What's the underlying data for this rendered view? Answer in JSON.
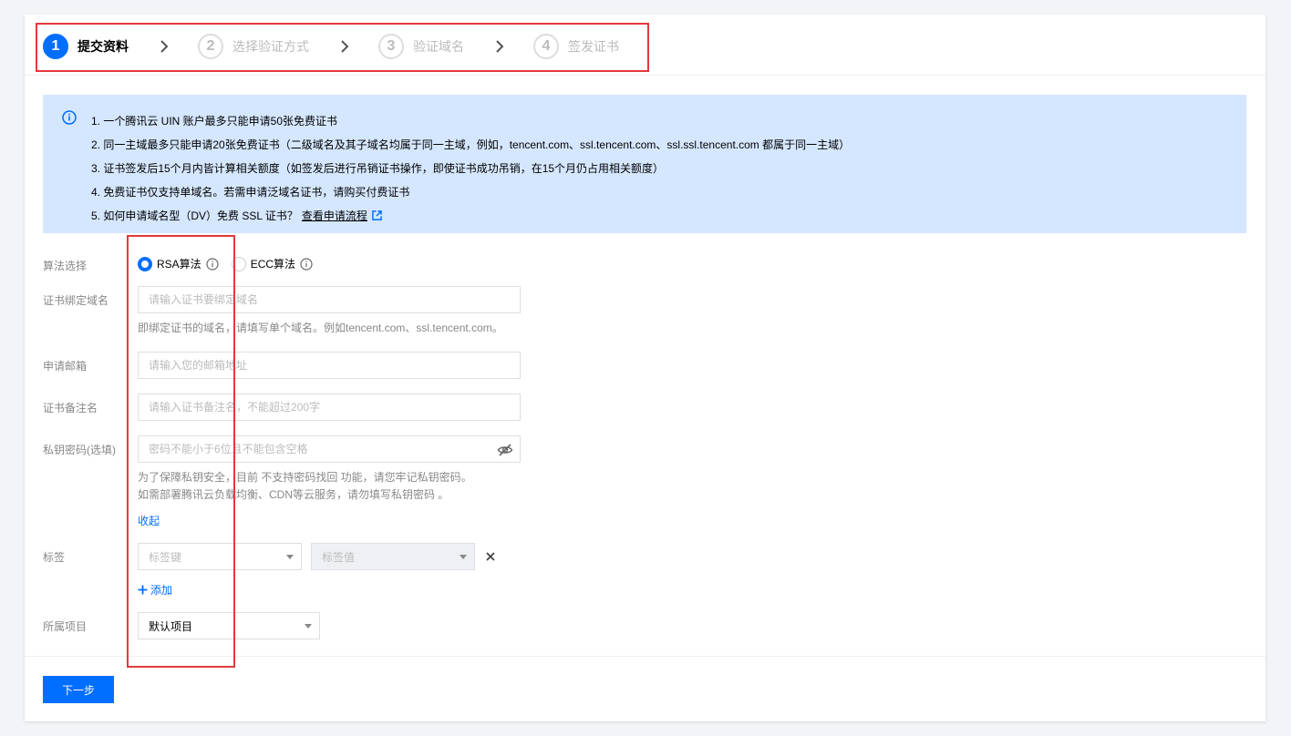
{
  "steps": [
    {
      "num": "1",
      "label": "提交资料"
    },
    {
      "num": "2",
      "label": "选择验证方式"
    },
    {
      "num": "3",
      "label": "验证域名"
    },
    {
      "num": "4",
      "label": "签发证书"
    }
  ],
  "notice": {
    "items": [
      "1. 一个腾讯云 UIN 账户最多只能申请50张免费证书",
      "2. 同一主域最多只能申请20张免费证书（二级域名及其子域名均属于同一主域，例如，tencent.com、ssl.tencent.com、ssl.ssl.tencent.com 都属于同一主域）",
      "3. 证书签发后15个月内皆计算相关额度（如签发后进行吊销证书操作，即使证书成功吊销，在15个月仍占用相关额度）",
      "4. 免费证书仅支持单域名。若需申请泛域名证书，请购买付费证书"
    ],
    "item5_text": "5. 如何申请域名型（DV）免费 SSL 证书？",
    "item5_link": "查看申请流程"
  },
  "form": {
    "algorithm": {
      "label": "算法选择",
      "options": [
        "RSA算法",
        "ECC算法"
      ],
      "selected": "RSA算法"
    },
    "domain": {
      "label": "证书绑定域名",
      "placeholder": "请输入证书要绑定域名",
      "hint": "即绑定证书的域名，请填写单个域名。例如tencent.com、ssl.tencent.com。"
    },
    "email": {
      "label": "申请邮箱",
      "placeholder": "请输入您的邮箱地址"
    },
    "remark": {
      "label": "证书备注名",
      "placeholder": "请输入证书备注名，不能超过200字"
    },
    "password": {
      "label": "私钥密码(选填)",
      "placeholder": "密码不能小于6位且不能包含空格",
      "hint_line1": "为了保障私钥安全，目前 不支持密码找回 功能，请您牢记私钥密码。",
      "hint_line2": "如需部署腾讯云负载均衡、CDN等云服务，请勿填写私钥密码 。",
      "collapse": "收起"
    },
    "tags": {
      "label": "标签",
      "key_placeholder": "标签键",
      "value_placeholder": "标签值",
      "add": "添加"
    },
    "project": {
      "label": "所属项目",
      "value": "默认项目"
    }
  },
  "footer": {
    "next": "下一步"
  },
  "colors": {
    "primary": "#006eff",
    "notice_bg": "#d5e7ff",
    "highlight_box": "#e4393c"
  }
}
